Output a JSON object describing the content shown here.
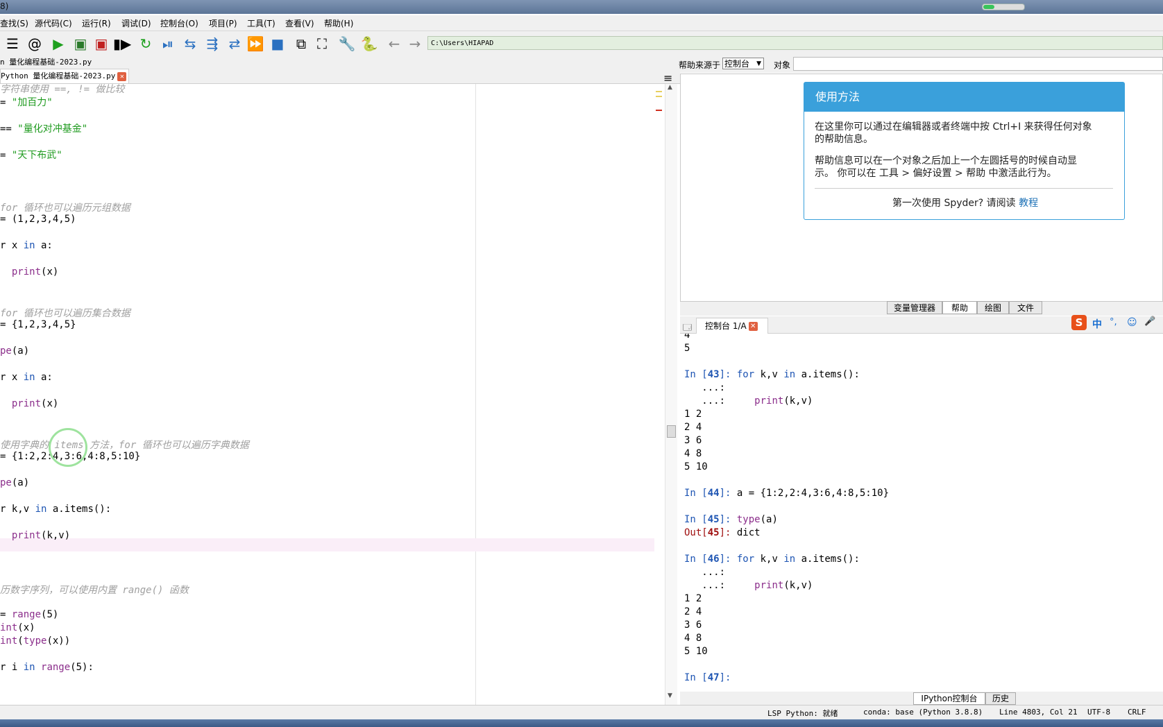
{
  "window": {
    "title_fragment": "8)"
  },
  "menu": [
    "查找(S)",
    "源代码(C)",
    "运行(R)",
    "调试(D)",
    "控制台(O)",
    "项目(P)",
    "工具(T)",
    "查看(V)",
    "帮助(H)"
  ],
  "toolbar": {
    "path": "C:\\Users\\HIAPAD",
    "icons": [
      "list-icon",
      "at-icon",
      "run-icon",
      "run-cell-icon",
      "run-cell-advance-icon",
      "run-selection-icon",
      "rerun-icon",
      "debug-icon",
      "step-icon",
      "step-into-icon",
      "step-return-icon",
      "continue-icon",
      "stop-icon",
      "maximize-pane-icon",
      "fullscreen-icon",
      "wrench-icon",
      "python-path-icon",
      "back-arrow-icon",
      "forward-arrow-icon"
    ]
  },
  "editor": {
    "file_title": "n 量化编程基础-2023.py",
    "tab_label": "Python 量化编程基础-2023.py",
    "lines": [
      {
        "parts": [
          [
            "cm",
            "字符串使用 ==, != 做比较"
          ]
        ]
      },
      {
        "parts": [
          [
            "",
            "= "
          ],
          [
            "st",
            "\"加百力\""
          ]
        ]
      },
      {
        "parts": []
      },
      {
        "parts": [
          [
            "",
            "== "
          ],
          [
            "st",
            "\"量化对冲基金\""
          ]
        ]
      },
      {
        "parts": []
      },
      {
        "parts": [
          [
            "",
            "= "
          ],
          [
            "st",
            "\"天下布武\""
          ]
        ]
      },
      {
        "parts": []
      },
      {
        "parts": []
      },
      {
        "parts": []
      },
      {
        "parts": [
          [
            "cm",
            "for 循环也可以遍历元组数据"
          ]
        ]
      },
      {
        "parts": [
          [
            "",
            "= (1,2,3,4,5)"
          ]
        ]
      },
      {
        "parts": []
      },
      {
        "parts": [
          [
            "",
            "r x "
          ],
          [
            "kw",
            "in"
          ],
          [
            "",
            " a:"
          ]
        ]
      },
      {
        "parts": []
      },
      {
        "parts": [
          [
            "",
            "  "
          ],
          [
            "bi",
            "print"
          ],
          [
            "",
            "(x)"
          ]
        ]
      },
      {
        "parts": []
      },
      {
        "parts": []
      },
      {
        "parts": [
          [
            "cm",
            "for 循环也可以遍历集合数据"
          ]
        ]
      },
      {
        "parts": [
          [
            "",
            "= {1,2,3,4,5}"
          ]
        ]
      },
      {
        "parts": []
      },
      {
        "parts": [
          [
            "bi",
            "pe"
          ],
          [
            "",
            "(a)"
          ]
        ]
      },
      {
        "parts": []
      },
      {
        "parts": [
          [
            "",
            "r x "
          ],
          [
            "kw",
            "in"
          ],
          [
            "",
            " a:"
          ]
        ]
      },
      {
        "parts": []
      },
      {
        "parts": [
          [
            "",
            "  "
          ],
          [
            "bi",
            "print"
          ],
          [
            "",
            "(x)"
          ]
        ]
      },
      {
        "parts": []
      },
      {
        "parts": []
      },
      {
        "parts": [
          [
            "cm",
            "使用字典的 items 方法，for 循环也可以遍历字典数据"
          ]
        ]
      },
      {
        "parts": [
          [
            "",
            "= {1:2,2:4,3:6,4:8,5:10}"
          ]
        ]
      },
      {
        "parts": []
      },
      {
        "parts": [
          [
            "bi",
            "pe"
          ],
          [
            "",
            "(a)"
          ]
        ]
      },
      {
        "parts": []
      },
      {
        "parts": [
          [
            "",
            "r k,v "
          ],
          [
            "kw",
            "in"
          ],
          [
            "",
            " a.items():"
          ]
        ]
      },
      {
        "parts": []
      },
      {
        "parts": [
          [
            "",
            "  "
          ],
          [
            "bi",
            "print"
          ],
          [
            "",
            "(k,v)"
          ]
        ]
      },
      {
        "parts": []
      },
      {
        "parts": []
      },
      {
        "parts": []
      },
      {
        "parts": [
          [
            "cm",
            "历数字序列，可以使用内置 range() 函数"
          ]
        ]
      },
      {
        "parts": []
      },
      {
        "parts": [
          [
            "",
            "= "
          ],
          [
            "bi",
            "range"
          ],
          [
            "",
            "(5)"
          ]
        ]
      },
      {
        "parts": [
          [
            "bi",
            "int"
          ],
          [
            "",
            "(x)"
          ]
        ]
      },
      {
        "parts": [
          [
            "bi",
            "int"
          ],
          [
            "",
            "("
          ],
          [
            "bi",
            "type"
          ],
          [
            "",
            "(x))"
          ]
        ]
      },
      {
        "parts": []
      },
      {
        "parts": [
          [
            "",
            "r i "
          ],
          [
            "kw",
            "in"
          ],
          [
            "",
            " "
          ],
          [
            "bi",
            "range"
          ],
          [
            "",
            "(5):"
          ]
        ]
      }
    ]
  },
  "help": {
    "source_label": "帮助来源于",
    "source_value": "控制台",
    "object_label": "对象",
    "card_title": "使用方法",
    "p1_line1": "在这里你可以通过在编辑器或者终端中按 Ctrl+I 来获得任何对象",
    "p1_line2": "的帮助信息。",
    "p2_line1": "帮助信息可以在一个对象之后加上一个左圆括号的时候自动显",
    "p2_line2": "示。 你可以在 工具 > 偏好设置 > 帮助 中激活此行为。",
    "footer": "第一次使用 Spyder? 请阅读",
    "footer_link": "教程"
  },
  "pane_tabs": [
    "变量管理器",
    "帮助",
    "绘图",
    "文件"
  ],
  "console": {
    "tab_label": "控制台 1/A",
    "ime": [
      "中",
      "°,",
      "☺",
      "🎤"
    ],
    "lines": [
      {
        "t": "plain",
        "s": "4"
      },
      {
        "t": "plain",
        "s": "5"
      },
      {
        "t": "blank"
      },
      {
        "t": "in",
        "n": "43",
        "code": [
          [
            "kw",
            "for"
          ],
          [
            "",
            " k,v "
          ],
          [
            "kw",
            "in"
          ],
          [
            "",
            " a.items():"
          ]
        ]
      },
      {
        "t": "cont",
        "s": "   ...:"
      },
      {
        "t": "cont",
        "s": "   ...:     ",
        "code": [
          [
            "bi",
            "print"
          ],
          [
            "",
            "(k,v)"
          ]
        ]
      },
      {
        "t": "plain",
        "s": "1 2"
      },
      {
        "t": "plain",
        "s": "2 4"
      },
      {
        "t": "plain",
        "s": "3 6"
      },
      {
        "t": "plain",
        "s": "4 8"
      },
      {
        "t": "plain",
        "s": "5 10"
      },
      {
        "t": "blank"
      },
      {
        "t": "in",
        "n": "44",
        "code": [
          [
            "",
            "a = {1:2,2:4,3:6,4:8,5:10}"
          ]
        ]
      },
      {
        "t": "blank"
      },
      {
        "t": "in",
        "n": "45",
        "code": [
          [
            "bi",
            "type"
          ],
          [
            "",
            "(a)"
          ]
        ]
      },
      {
        "t": "out",
        "n": "45",
        "s": "dict"
      },
      {
        "t": "blank"
      },
      {
        "t": "in",
        "n": "46",
        "code": [
          [
            "kw",
            "for"
          ],
          [
            "",
            " k,v "
          ],
          [
            "kw",
            "in"
          ],
          [
            "",
            " a.items():"
          ]
        ]
      },
      {
        "t": "cont",
        "s": "   ...:"
      },
      {
        "t": "cont",
        "s": "   ...:     ",
        "code": [
          [
            "bi",
            "print"
          ],
          [
            "",
            "(k,v)"
          ]
        ]
      },
      {
        "t": "plain",
        "s": "1 2"
      },
      {
        "t": "plain",
        "s": "2 4"
      },
      {
        "t": "plain",
        "s": "3 6"
      },
      {
        "t": "plain",
        "s": "4 8"
      },
      {
        "t": "plain",
        "s": "5 10"
      },
      {
        "t": "blank"
      },
      {
        "t": "in",
        "n": "47",
        "code": []
      }
    ],
    "bottom_tabs": [
      "IPython控制台",
      "历史"
    ]
  },
  "status": {
    "lsp": "LSP Python: 就绪",
    "env": "conda: base (Python 3.8.8)",
    "position": "Line 4803, Col 21",
    "encoding": "UTF-8",
    "eol": "CRLF"
  },
  "colors": {
    "accent": "#3aa0db",
    "string": "#1e9a1e",
    "keyword": "#1e55b3",
    "builtin": "#8b2e8b",
    "comment": "#a0a0a0"
  }
}
